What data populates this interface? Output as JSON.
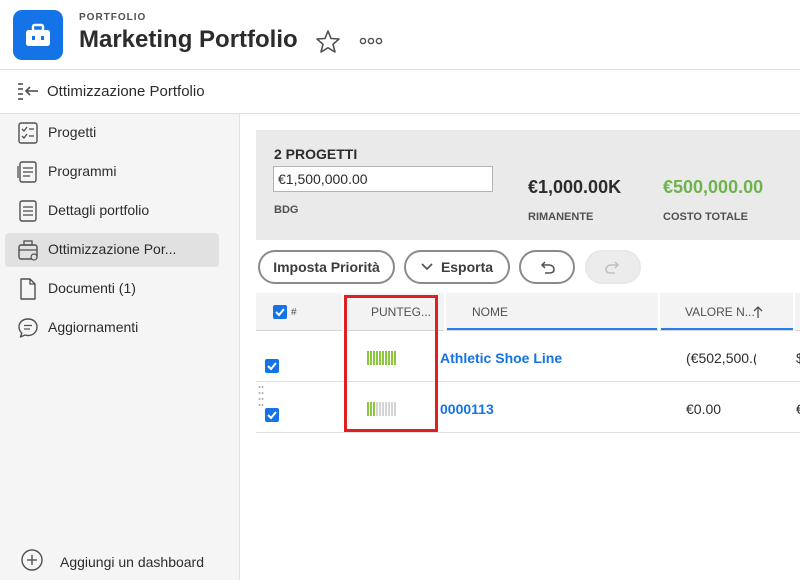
{
  "header": {
    "eyebrow": "PORTFOLIO",
    "title": "Marketing Portfolio",
    "app_icon": "briefcase-icon",
    "brand_color": "#1473e6"
  },
  "subbar": {
    "label": "Ottimizzazione Portfolio"
  },
  "sidebar": {
    "items": [
      {
        "label": "Progetti",
        "icon": "projects-icon",
        "active": false
      },
      {
        "label": "Programmi",
        "icon": "programs-icon",
        "active": false
      },
      {
        "label": "Dettagli portfolio",
        "icon": "details-icon",
        "active": false
      },
      {
        "label": "Ottimizzazione Por...",
        "icon": "optimizer-icon",
        "active": true
      },
      {
        "label": "Documenti (1)",
        "icon": "document-icon",
        "active": false
      },
      {
        "label": "Aggiornamenti",
        "icon": "updates-icon",
        "active": false
      }
    ],
    "add_dashboard": "Aggiungi un dashboard"
  },
  "summary": {
    "count": "2 PROGETTI",
    "budget_value": "€1,500,000.00",
    "budget_label": "BDG",
    "remaining_value": "€1,000.00K",
    "remaining_label": "RIMANENTE",
    "total_cost_value": "€500,000.00",
    "total_cost_label": "COSTO TOTALE",
    "total_cost_color": "#6fb34f"
  },
  "toolbar": {
    "set_priority": "Imposta Priorità",
    "export": "Esporta"
  },
  "table": {
    "columns": [
      "#",
      "PUNTEG...",
      "NOME",
      "VALORE N..."
    ],
    "rows": [
      {
        "name": "Athletic Shoe Line",
        "value": "(€502,500.(",
        "score_filled": 10,
        "score_total": 10
      },
      {
        "name": "0000113",
        "value": "€0.00",
        "score_filled": 3,
        "score_total": 10
      }
    ]
  },
  "colors": {
    "score_on": "#8cc63f",
    "score_off": "#d4d4d4",
    "highlight": "#e02020"
  }
}
